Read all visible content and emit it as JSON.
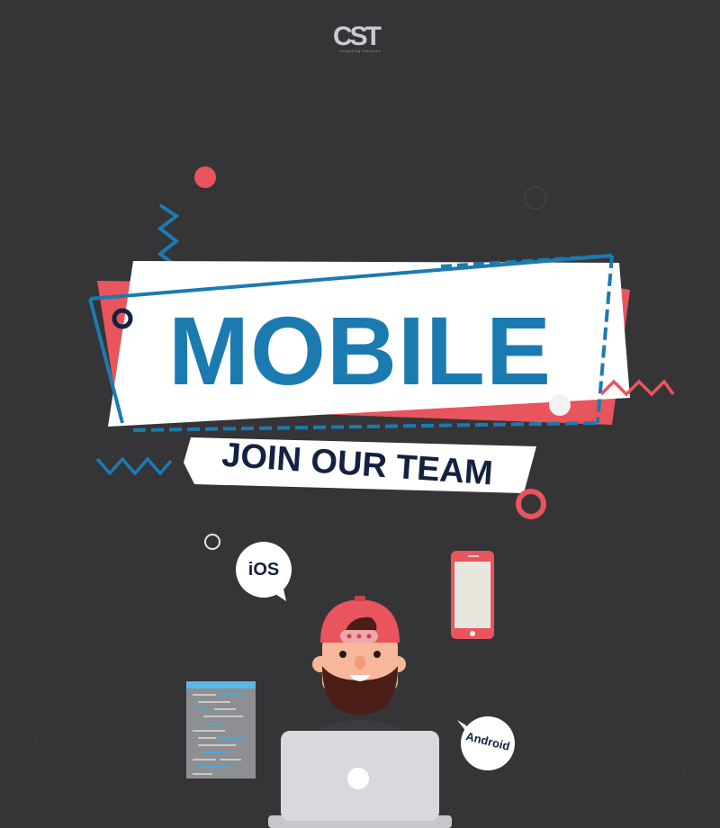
{
  "brand": {
    "logo_text": "CST",
    "logo_tagline": "Consulting Solutions"
  },
  "headline": {
    "title": "MOBILE",
    "subtitle": "JOIN OUR TEAM"
  },
  "bubbles": {
    "ios": "iOS",
    "android": "Android"
  },
  "colors": {
    "background": "#353538",
    "accent_blue": "#1b7bb0",
    "accent_coral": "#e8555d",
    "navy": "#132240",
    "white": "#ffffff"
  },
  "icons": {
    "phone": "smartphone-icon",
    "laptop": "laptop-icon",
    "code": "code-window-icon",
    "developer": "bearded-developer-illustration"
  }
}
